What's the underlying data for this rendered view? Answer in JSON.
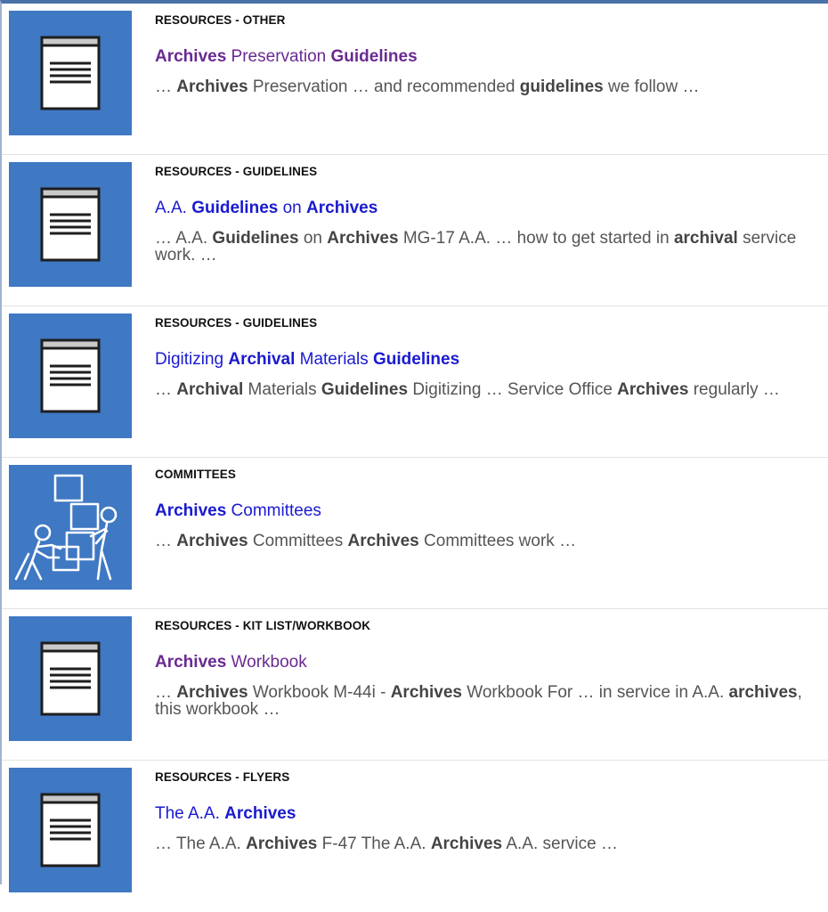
{
  "colors": {
    "thumb_bg": "#3f78c3",
    "link": "#1a1ad0",
    "visited_link": "#6a2a91",
    "snippet_text": "#555555",
    "top_border": "#4a72a8"
  },
  "results": [
    {
      "category": "RESOURCES - OTHER",
      "icon": "document-icon",
      "visited": true,
      "title": [
        {
          "text": "Archives",
          "bold": true
        },
        {
          "text": " Preservation ",
          "bold": false
        },
        {
          "text": "Guidelines",
          "bold": true
        }
      ],
      "snippet": [
        {
          "text": "… ",
          "bold": false
        },
        {
          "text": "Archives",
          "bold": true
        },
        {
          "text": " Preservation … and recommended ",
          "bold": false
        },
        {
          "text": "guidelines",
          "bold": true
        },
        {
          "text": " we follow …",
          "bold": false
        }
      ]
    },
    {
      "category": "RESOURCES - GUIDELINES",
      "icon": "document-icon",
      "visited": false,
      "title": [
        {
          "text": "A.A. ",
          "bold": false
        },
        {
          "text": "Guidelines",
          "bold": true
        },
        {
          "text": " on ",
          "bold": false
        },
        {
          "text": "Archives",
          "bold": true
        }
      ],
      "snippet": [
        {
          "text": "… A.A. ",
          "bold": false
        },
        {
          "text": "Guidelines",
          "bold": true
        },
        {
          "text": " on ",
          "bold": false
        },
        {
          "text": "Archives",
          "bold": true
        },
        {
          "text": " MG-17 A.A. … how to get started in ",
          "bold": false
        },
        {
          "text": "archival",
          "bold": true
        },
        {
          "text": " service work. …",
          "bold": false
        }
      ]
    },
    {
      "category": "RESOURCES - GUIDELINES",
      "icon": "document-icon",
      "visited": false,
      "title": [
        {
          "text": "Digitizing ",
          "bold": false
        },
        {
          "text": "Archival",
          "bold": true
        },
        {
          "text": " Materials ",
          "bold": false
        },
        {
          "text": "Guidelines",
          "bold": true
        }
      ],
      "snippet": [
        {
          "text": "… ",
          "bold": false
        },
        {
          "text": "Archival",
          "bold": true
        },
        {
          "text": " Materials ",
          "bold": false
        },
        {
          "text": "Guidelines",
          "bold": true
        },
        {
          "text": " Digitizing … Service Office ",
          "bold": false
        },
        {
          "text": "Archives",
          "bold": true
        },
        {
          "text": " regularly …",
          "bold": false
        }
      ]
    },
    {
      "category": "COMMITTEES",
      "icon": "people-moving-boxes-icon",
      "visited": false,
      "title": [
        {
          "text": "Archives",
          "bold": true
        },
        {
          "text": " Committees",
          "bold": false
        }
      ],
      "snippet": [
        {
          "text": "… ",
          "bold": false
        },
        {
          "text": "Archives",
          "bold": true
        },
        {
          "text": " Committees ",
          "bold": false
        },
        {
          "text": "Archives",
          "bold": true
        },
        {
          "text": " Committees work …",
          "bold": false
        }
      ]
    },
    {
      "category": "RESOURCES - KIT LIST/WORKBOOK",
      "icon": "document-icon",
      "visited": true,
      "title": [
        {
          "text": "Archives",
          "bold": true
        },
        {
          "text": " Workbook",
          "bold": false
        }
      ],
      "snippet": [
        {
          "text": "… ",
          "bold": false
        },
        {
          "text": "Archives",
          "bold": true
        },
        {
          "text": " Workbook M-44i - ",
          "bold": false
        },
        {
          "text": "Archives",
          "bold": true
        },
        {
          "text": " Workbook For … in service in A.A. ",
          "bold": false
        },
        {
          "text": "archives",
          "bold": true
        },
        {
          "text": ", this workbook …",
          "bold": false
        }
      ]
    },
    {
      "category": "RESOURCES - FLYERS",
      "icon": "document-icon",
      "visited": false,
      "title": [
        {
          "text": "The A.A. ",
          "bold": false
        },
        {
          "text": "Archives",
          "bold": true
        }
      ],
      "snippet": [
        {
          "text": "… The A.A. ",
          "bold": false
        },
        {
          "text": "Archives",
          "bold": true
        },
        {
          "text": " F-47 The A.A. ",
          "bold": false
        },
        {
          "text": "Archives",
          "bold": true
        },
        {
          "text": " A.A. service …",
          "bold": false
        }
      ]
    }
  ]
}
